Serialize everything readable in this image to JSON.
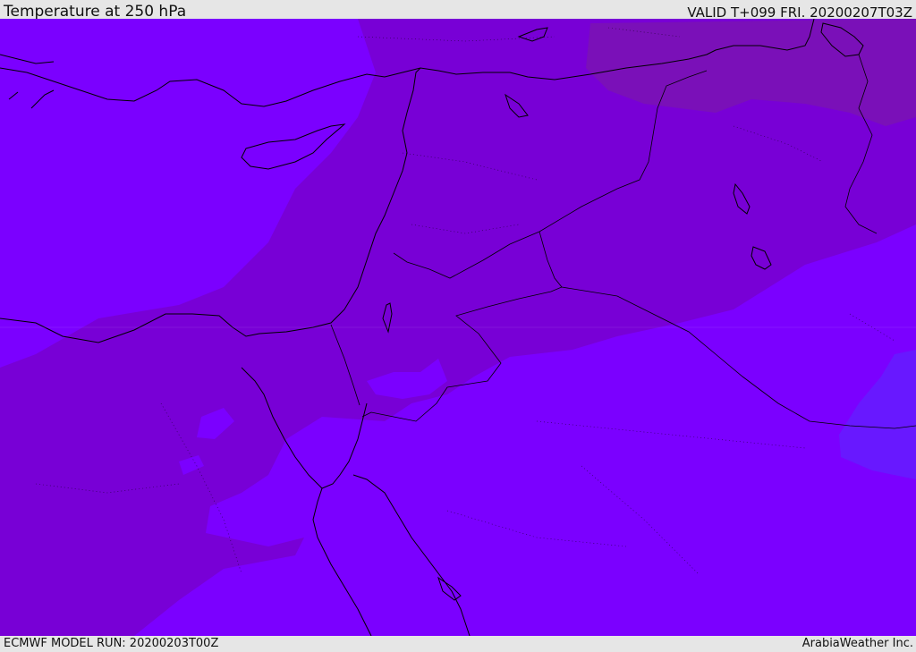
{
  "header": {
    "title": "Temperature at 250 hPa",
    "valid": "VALID T+099 FRI. 20200207T03Z"
  },
  "footer": {
    "model_run": "ECMWF MODEL RUN: 20200203T00Z",
    "credit": "ArabiaWeather Inc."
  },
  "colors": {
    "field_base": "#7b00ff",
    "field_warm": "#7800d6",
    "field_warmer": "#7a10b8",
    "field_cold": "#6818ff",
    "coastline": "#000000",
    "border": "#000000"
  }
}
